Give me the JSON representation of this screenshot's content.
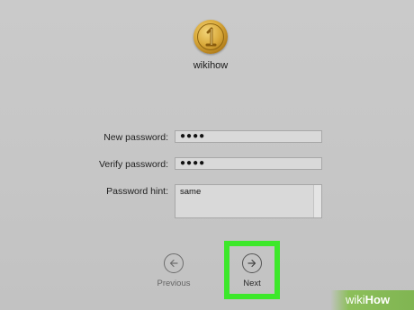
{
  "user": {
    "name": "wikihow",
    "avatar_icon": "gold-coin-avatar-icon"
  },
  "form": {
    "new_password": {
      "label": "New password:",
      "value": "●●●●"
    },
    "verify_password": {
      "label": "Verify password:",
      "value": "●●●●"
    },
    "password_hint": {
      "label": "Password hint:",
      "value": "same"
    }
  },
  "nav": {
    "previous_label": "Previous",
    "previous_icon": "arrow-left-circle-icon",
    "next_label": "Next",
    "next_icon": "arrow-right-circle-icon"
  },
  "highlight_color": "#3ce82a",
  "watermark": {
    "part1": "wiki",
    "part2": "How"
  }
}
